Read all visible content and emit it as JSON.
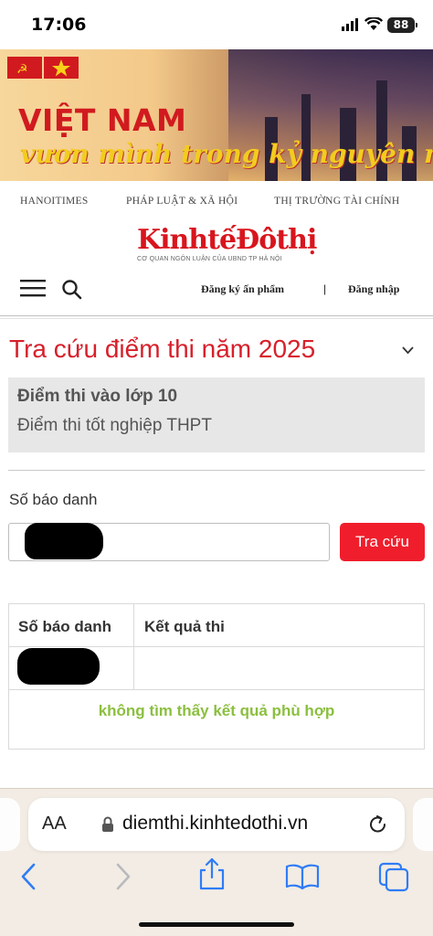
{
  "status_bar": {
    "time": "17:06",
    "battery": "88"
  },
  "banner": {
    "title": "VIỆT NAM",
    "subtitle": "vươn mình trong kỷ nguyên mới"
  },
  "top_nav": {
    "items": [
      "HANOITIMES",
      "PHÁP LUẬT & XÃ HỘI",
      "THỊ TRƯỜNG TÀI CHÍNH"
    ]
  },
  "logo": {
    "text": "KinhtếĐôthị",
    "tagline": "CƠ QUAN NGÔN LUẬN CỦA UBND TP HÀ NỘI"
  },
  "header": {
    "signup_label": "Đăng ký ấn phẩm",
    "separator": "|",
    "login_label": "Đăng nhập"
  },
  "main": {
    "heading": "Tra cứu điểm thi năm 2025",
    "options": [
      "Điểm thi vào lớp 10",
      "Điểm thi tốt nghiệp THPT"
    ],
    "field_label": "Số báo danh",
    "search_button": "Tra cứu",
    "table": {
      "headers": [
        "Số báo danh",
        "Kết quả thi"
      ],
      "empty_message": "không tìm thấy kết quả phù hợp"
    }
  },
  "browser": {
    "text_size_label": "AA",
    "url": "diemthi.kinhtedothi.vn"
  },
  "colors": {
    "accent": "#d7202b",
    "button": "#f01e2c",
    "no_result": "#8bbf3f",
    "ios_blue": "#2f7cf6"
  }
}
